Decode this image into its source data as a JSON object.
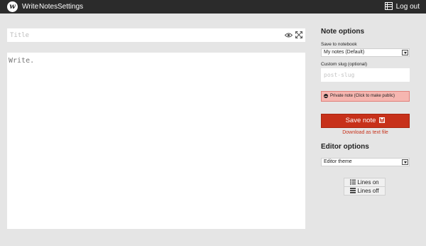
{
  "nav": {
    "logo_glyph": "w",
    "items": [
      "Write",
      "Notes",
      "Settings"
    ],
    "logout_label": "Log out",
    "bar_color": "#2b2b2b"
  },
  "editor": {
    "title_placeholder": "Title",
    "body_placeholder": "Write."
  },
  "sidebar": {
    "note_options_title": "Note options",
    "notebook_label": "Save to notebook",
    "notebook_selected": "My notes (Default)",
    "slug_label": "Custom slug (optional)",
    "slug_placeholder": "post-slug",
    "private_label": "Private note (Click to make public)",
    "save_label": "Save note",
    "download_label": "Download as text file",
    "editor_options_title": "Editor options",
    "theme_selected": "Editor theme",
    "lines_on_label": "Lines on",
    "lines_off_label": "Lines off"
  },
  "colors": {
    "accent": "#c7311a",
    "private_bg": "#f6b6b0",
    "page_bg": "#e5e5e5"
  }
}
